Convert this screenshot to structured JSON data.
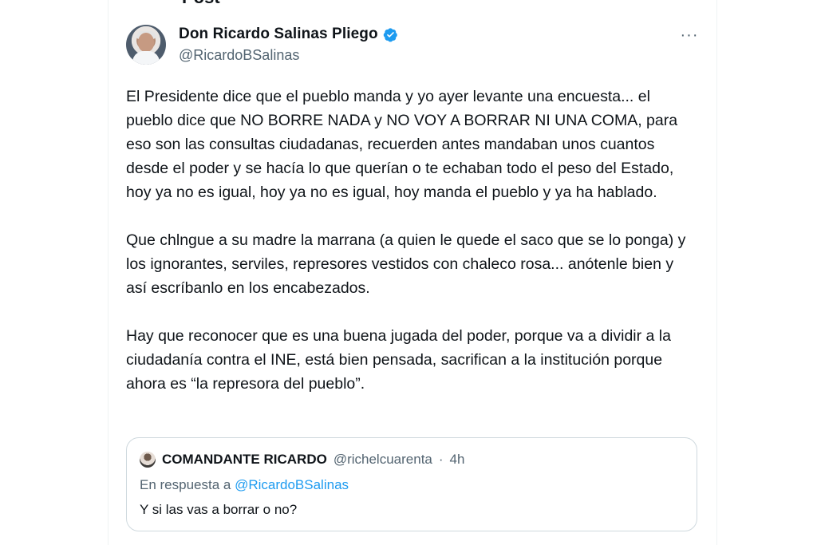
{
  "header": {
    "title": "Post"
  },
  "author": {
    "display_name": "Don Ricardo Salinas Pliego",
    "handle": "@RicardoBSalinas",
    "verified": true,
    "avatar": "profile-photo"
  },
  "actions": {
    "more_label": "···"
  },
  "post": {
    "paragraphs": [
      "El Presidente dice que el pueblo manda y yo ayer levante una encuesta... el pueblo dice que NO BORRE NADA y NO VOY A BORRAR NI UNA COMA, para eso son las consultas ciudadanas, recuerden antes mandaban unos cuantos desde el poder y se hacía lo que querían o te echaban todo el peso del Estado, hoy ya no es igual, hoy ya no es igual, hoy manda el pueblo y ya ha hablado.",
      "Que chlngue a su madre la marrana (a quien le quede el saco que se lo ponga) y los ignorantes, serviles, represores vestidos con chaleco rosa... anótenle bien y así escríbanlo en los encabezados.",
      "Hay que reconocer que es una buena jugada del poder, porque va a dividir a la ciudadanía contra el INE, está bien pensada, sacrifican a la institución porque ahora es “la represora del pueblo”."
    ]
  },
  "quoted": {
    "name": "COMANDANTE RICARDO",
    "handle": "@richelcuarenta",
    "separator": "·",
    "time": "4h",
    "reply_prefix": "En respuesta a",
    "reply_mention": "@RicardoBSalinas",
    "text": "Y si las vas a borrar o no?"
  },
  "colors": {
    "text": "#0f1419",
    "secondary": "#536471",
    "accent": "#1d9bf0",
    "border": "#cfd9de"
  }
}
